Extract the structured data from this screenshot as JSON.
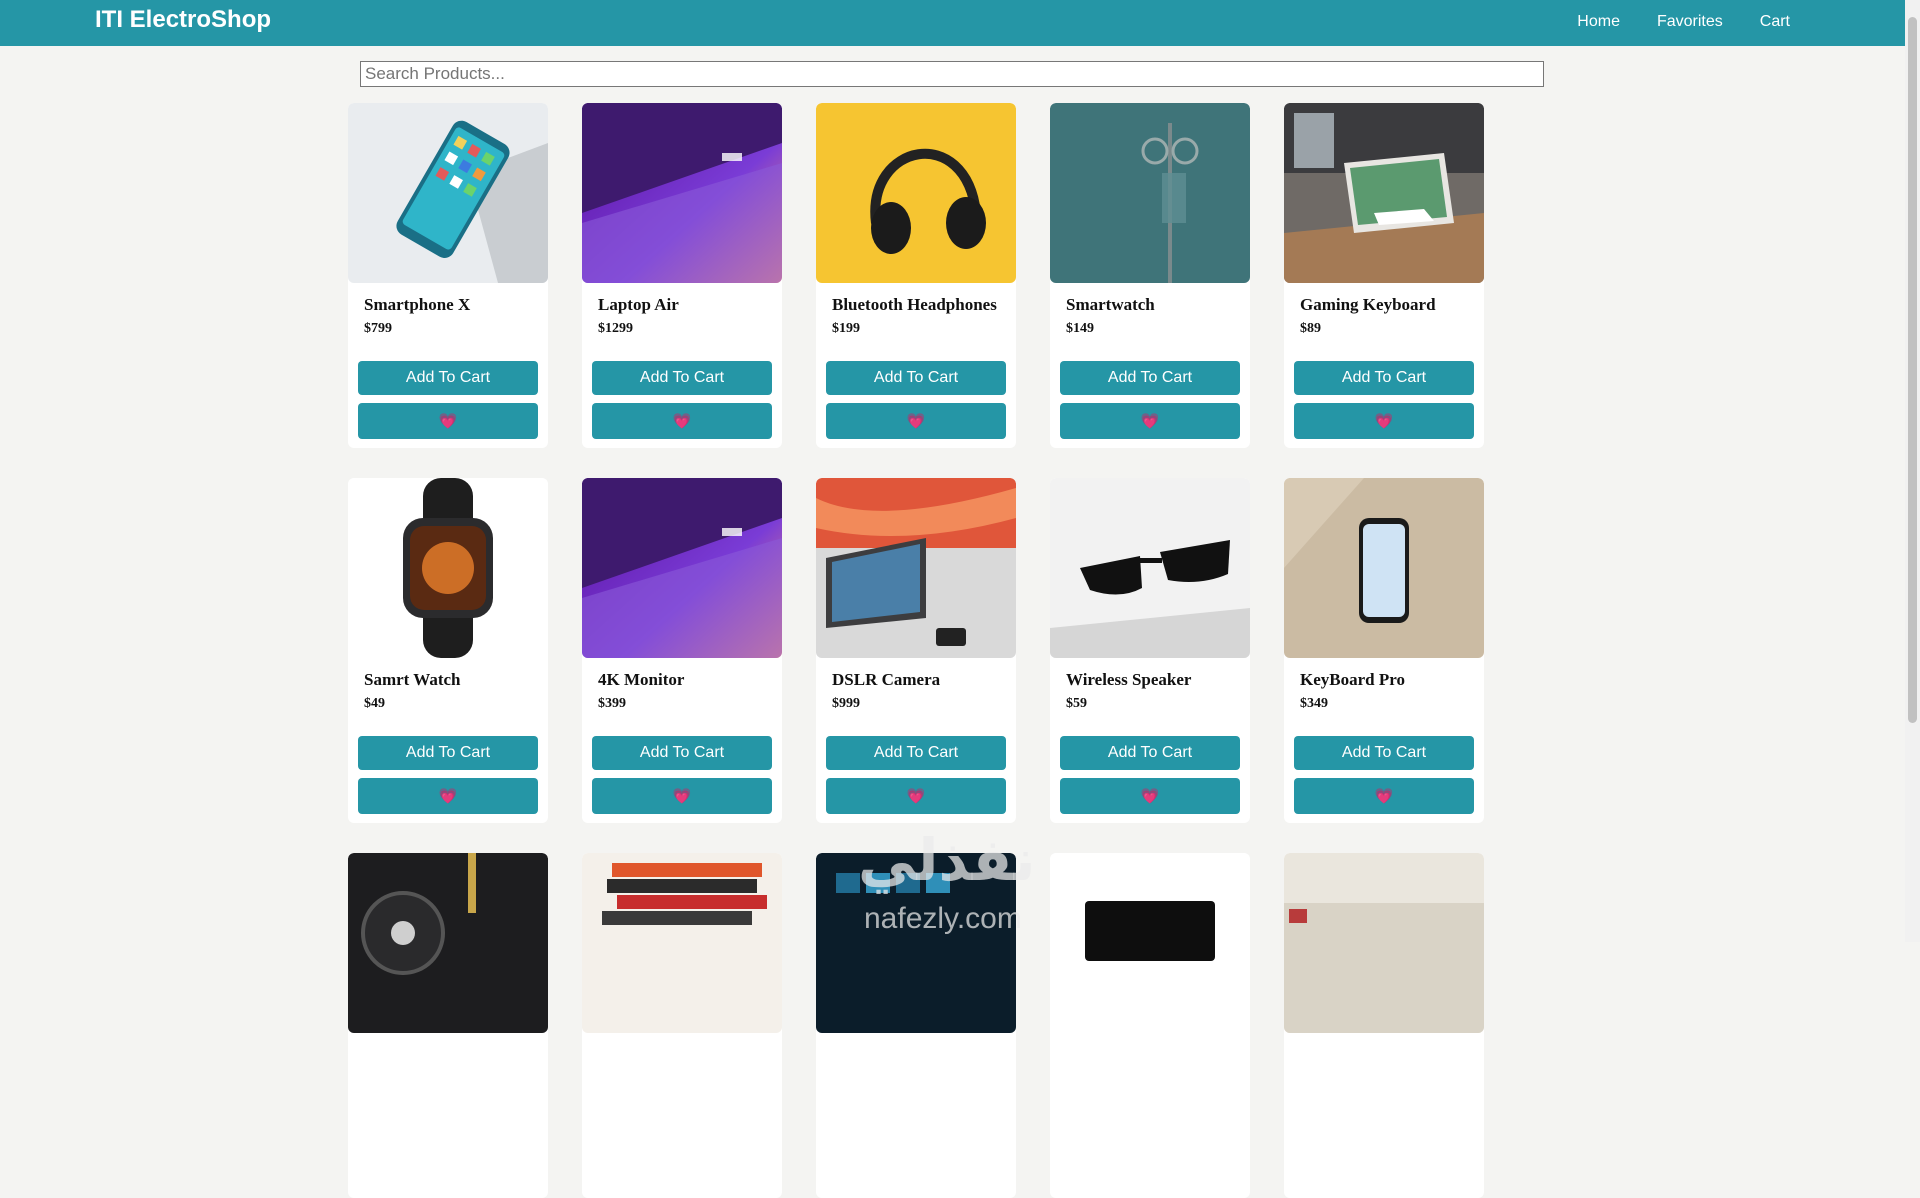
{
  "header": {
    "brand": "ITI ElectroShop",
    "nav": [
      "Home",
      "Favorites",
      "Cart"
    ]
  },
  "search": {
    "placeholder": "Search Products..."
  },
  "button_label": "Add To Cart",
  "favorite_glyph": "💗",
  "colors": {
    "primary": "#2596a6",
    "background": "#f4f4f2",
    "heart": "#e8477a"
  },
  "products": [
    {
      "name": "Smartphone X",
      "price": "$799",
      "image": "smartphone-photo"
    },
    {
      "name": "Laptop Air",
      "price": "$1299",
      "image": "laptop-photo"
    },
    {
      "name": "Bluetooth Headphones",
      "price": "$199",
      "image": "headphones-photo"
    },
    {
      "name": "Smartwatch",
      "price": "$149",
      "image": "iv-stand-photo"
    },
    {
      "name": "Gaming Keyboard",
      "price": "$89",
      "image": "laptop-desk-photo"
    },
    {
      "name": "Samrt Watch",
      "price": "$49",
      "image": "watch-photo"
    },
    {
      "name": "4K Monitor",
      "price": "$399",
      "image": "laptop-photo"
    },
    {
      "name": "DSLR Camera",
      "price": "$999",
      "image": "monitor-laptop-photo"
    },
    {
      "name": "Wireless Speaker",
      "price": "$59",
      "image": "sunglasses-photo"
    },
    {
      "name": "KeyBoard Pro",
      "price": "$349",
      "image": "phone-on-wood-photo"
    }
  ],
  "watermark": {
    "arabic": "نفذلي",
    "latin": "nafezly.com"
  }
}
